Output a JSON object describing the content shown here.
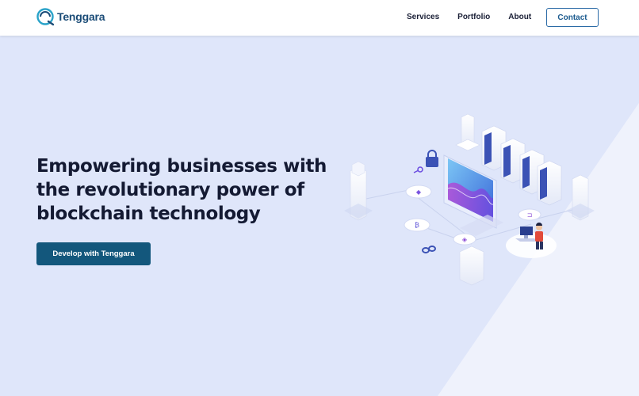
{
  "header": {
    "brand": "Tenggara",
    "logo_icon": "tenggara-logo-icon",
    "nav": [
      "Services",
      "Portfolio",
      "About"
    ],
    "contact_label": "Contact"
  },
  "hero": {
    "title_lines": [
      "Empowering businesses with",
      "the revolutionary power of",
      "blockchain technology"
    ],
    "cta_label": "Develop with Tenggara",
    "illustration": "isometric-blockchain-illustration"
  },
  "colors": {
    "brand": "#1c4d78",
    "hero_background": "#dfe6fa",
    "cta_background": "#13577c",
    "accent_border": "#2a6aa6"
  }
}
